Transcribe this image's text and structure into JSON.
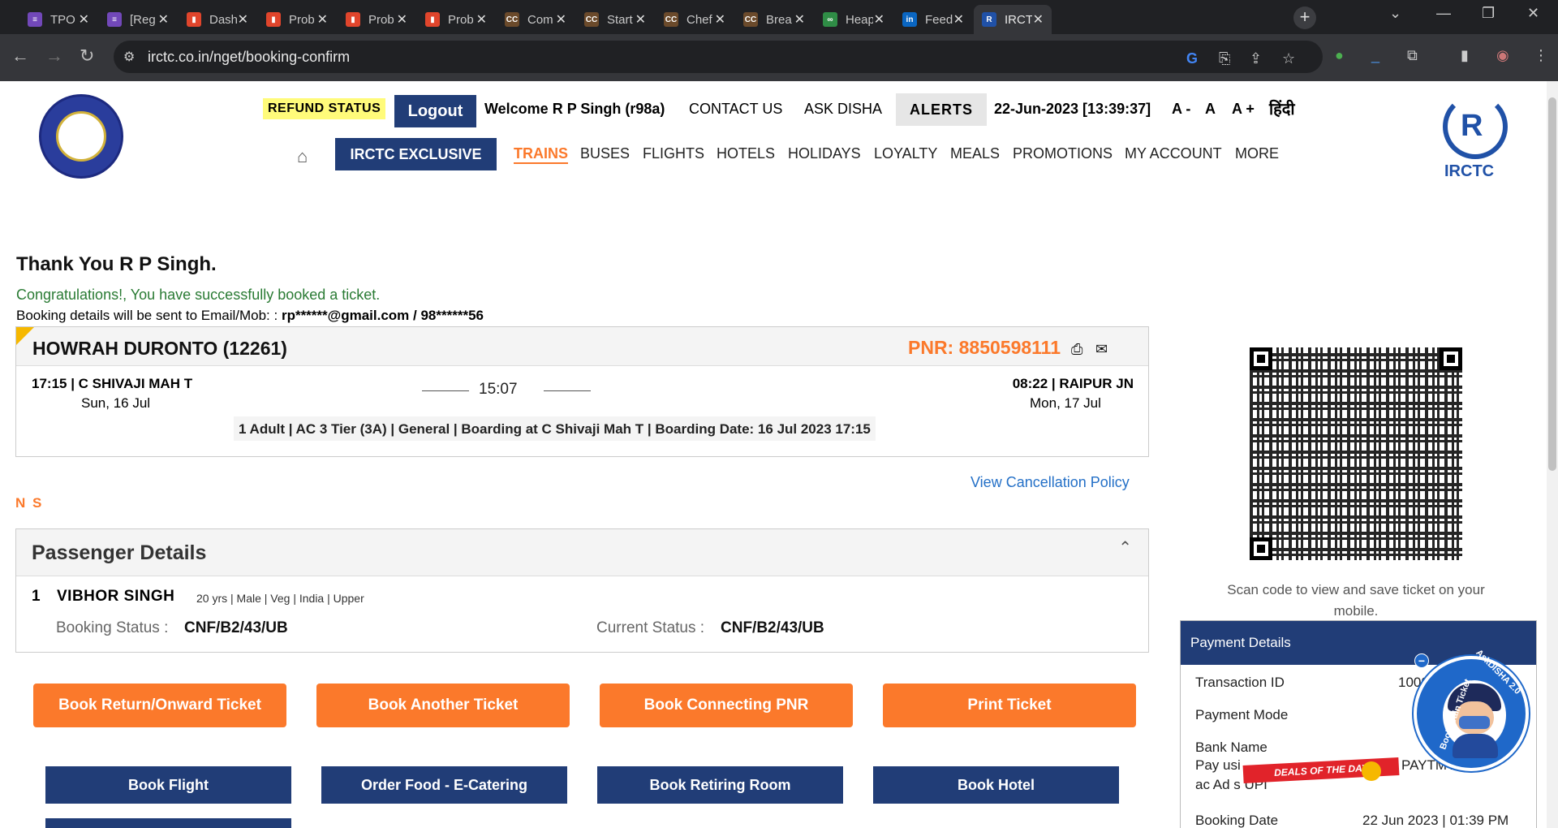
{
  "browser": {
    "tabs": [
      {
        "title": "TPO",
        "icon": "forms-icon",
        "color": "#7248b9"
      },
      {
        "title": "[Reg",
        "icon": "forms-icon",
        "color": "#7248b9"
      },
      {
        "title": "Dash",
        "icon": "bar-chart-icon",
        "color": "#e0452c"
      },
      {
        "title": "Prob",
        "icon": "bar-chart-icon",
        "color": "#e0452c"
      },
      {
        "title": "Prob",
        "icon": "bar-chart-icon",
        "color": "#e0452c"
      },
      {
        "title": "Prob",
        "icon": "bar-chart-icon",
        "color": "#e0452c"
      },
      {
        "title": "Com",
        "icon": "codechef-icon",
        "color": "#6b4a2b"
      },
      {
        "title": "Start",
        "icon": "codechef-icon",
        "color": "#6b4a2b"
      },
      {
        "title": "Chef",
        "icon": "codechef-icon",
        "color": "#6b4a2b"
      },
      {
        "title": "Brea",
        "icon": "codechef-icon",
        "color": "#6b4a2b"
      },
      {
        "title": "Heap",
        "icon": "gfg-icon",
        "color": "#2f8d46"
      },
      {
        "title": "Feed",
        "icon": "linkedin-icon",
        "color": "#0a66c2"
      },
      {
        "title": "IRCTC",
        "icon": "irctc-icon",
        "color": "#2051a7"
      }
    ],
    "url": "irctc.co.in/nget/booking-confirm"
  },
  "header": {
    "refund_status": "REFUND STATUS",
    "logout": "Logout",
    "welcome": "Welcome R P Singh (r98a)",
    "contact": "CONTACT US",
    "ask_disha": "ASK DISHA",
    "alerts": "ALERTS",
    "datetime": "22-Jun-2023 [13:39:37]",
    "font_small": "A -",
    "font_normal": "A",
    "font_large": "A +",
    "hindi": "हिंदी",
    "irctc_logo": "IRCTC",
    "exclusive": "IRCTC EXCLUSIVE",
    "menu": [
      "TRAINS",
      "BUSES",
      "FLIGHTS",
      "HOTELS",
      "HOLIDAYS",
      "LOYALTY",
      "MEALS",
      "PROMOTIONS",
      "MY ACCOUNT",
      "MORE"
    ]
  },
  "booking": {
    "thank_you": "Thank You R P Singh.",
    "congrats": "Congratulations!, You have successfully booked a ticket.",
    "sent_to_label": "Booking details will be sent to Email/Mob: :",
    "sent_to_value": "rp******@gmail.com / 98******56",
    "train_name": "HOWRAH DURONTO (12261)",
    "pnr": "PNR: 8850598111",
    "dep": "17:15 | C SHIVAJI MAH T",
    "dep_date": "Sun, 16 Jul",
    "duration": "15:07",
    "arr": "08:22 | RAIPUR JN",
    "arr_date": "Mon, 17 Jul",
    "journey": "1 Adult | AC 3 Tier (3A) | General | Boarding at C Shivaji Mah T | Boarding Date: 16 Jul 2023 17:15",
    "cancel_policy": "View Cancellation Policy",
    "ns": "N S"
  },
  "passengers": {
    "title": "Passenger Details",
    "list": [
      {
        "no": "1",
        "name": "VIBHOR SINGH",
        "meta": "20 yrs | Male | Veg | India | Upper",
        "booking_status_label": "Booking Status :",
        "booking_status": "CNF/B2/43/UB",
        "current_status_label": "Current Status :",
        "current_status": "CNF/B2/43/UB"
      }
    ]
  },
  "actions": {
    "orange": [
      "Book Return/Onward Ticket",
      "Book Another Ticket",
      "Book Connecting PNR",
      "Print Ticket"
    ],
    "blue": [
      "Book Flight",
      "Order Food - E-Catering",
      "Book Retiring Room",
      "Book Hotel"
    ]
  },
  "qr": {
    "scan_text": "Scan code to view and save ticket on your mobile."
  },
  "payment": {
    "title": "Payment Details",
    "rows": [
      {
        "label": "Transaction ID",
        "value": "1000"
      },
      {
        "label": "Payment Mode",
        "value": ""
      },
      {
        "label": "Bank Name",
        "value": ""
      },
      {
        "label": "Pay usi",
        "value": "PAYTM /"
      },
      {
        "label": "ac  Ad  s UPI",
        "value": ""
      },
      {
        "label": "Booking Date",
        "value": "22 Jun 2023 | 01:39 PM"
      }
    ]
  },
  "widgets": {
    "ask_disha_label": "AskDISHA 2.0",
    "ask_disha_sub": "Book Train Ticket",
    "deals": "DEALS OF THE DAY"
  },
  "colors": {
    "brand_blue": "#213d77",
    "brand_orange": "#fb792b",
    "success_green": "#2a7b34",
    "link_blue": "#2470c7"
  }
}
